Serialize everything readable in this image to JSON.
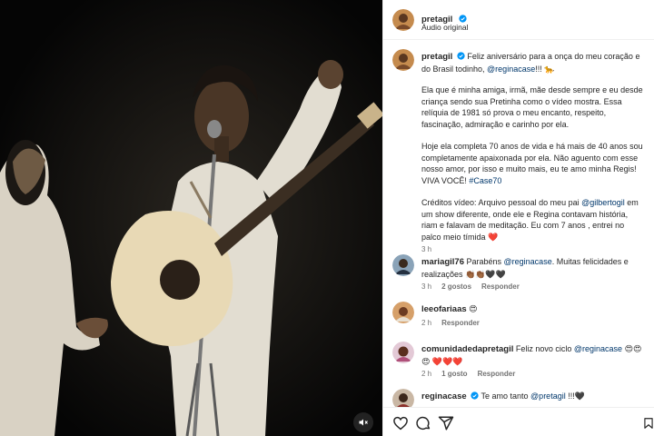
{
  "post": {
    "author": "pretagil",
    "audio": "Áudio original",
    "author_color": "#262626",
    "link_color": "#00376b",
    "verified_color": "#0095f6"
  },
  "caption": {
    "username": "pretagil",
    "line1_text": "Feliz aniversário para a onça do meu coração e do Brasil todinho, ",
    "line1_mention": "@reginacase",
    "line1_end": "!!! 🐆",
    "para2": "Ela que é minha amiga, irmã, mãe desde sempre e eu desde criança sendo sua Pretinha como o vídeo mostra. Essa relíquia de 1981 só prova o meu encanto, respeito, fascinação, admiração e carinho por ela.",
    "para3_text": "Hoje ela completa 70 anos de vida e há mais de 40 anos sou completamente apaixonada por ela. Não aguento com esse nosso amor, por isso e muito mais, eu te amo minha Regis! VIVA VOCÊ! ",
    "para3_tag": "#Case70",
    "para4_text": "Créditos vídeo: Arquivo pessoal do meu pai ",
    "para4_mention": "@gilbertogil",
    "para4_end": " em um show diferente, onde ele e Regina contavam história, riam e falavam de meditação. Eu com 7 anos , entrei no palco meio tímida ❤️",
    "time": "3 h"
  },
  "comments": [
    {
      "username": "mariagil76",
      "text": " Parabéns ",
      "mention": "@reginacase",
      "end": ". Muitas felicidades e realizações 👏🏾👏🏾🖤🖤",
      "time": "3 h",
      "likes": "2 gostos",
      "reply": "Responder"
    },
    {
      "username": "leeofariaas",
      "text": " 😍",
      "mention": "",
      "end": "",
      "time": "2 h",
      "likes": "",
      "reply": "Responder"
    },
    {
      "username": "comunidadedapretagil",
      "text": " Feliz novo ciclo ",
      "mention": "@reginacase",
      "end": " 😍😍😍 ❤️❤️❤️",
      "time": "2 h",
      "likes": "1 gosto",
      "reply": "Responder"
    },
    {
      "username": "reginacase",
      "text": " Te amo tanto ",
      "mention": "@pretagil",
      "end": " !!!🖤",
      "time": "",
      "likes": "",
      "reply": ""
    }
  ],
  "icons": {
    "like": "heart-icon",
    "comment": "comment-icon",
    "share": "share-icon",
    "save": "bookmark-icon",
    "audio": "speaker-muted-icon",
    "verified": "verified-badge-icon"
  }
}
